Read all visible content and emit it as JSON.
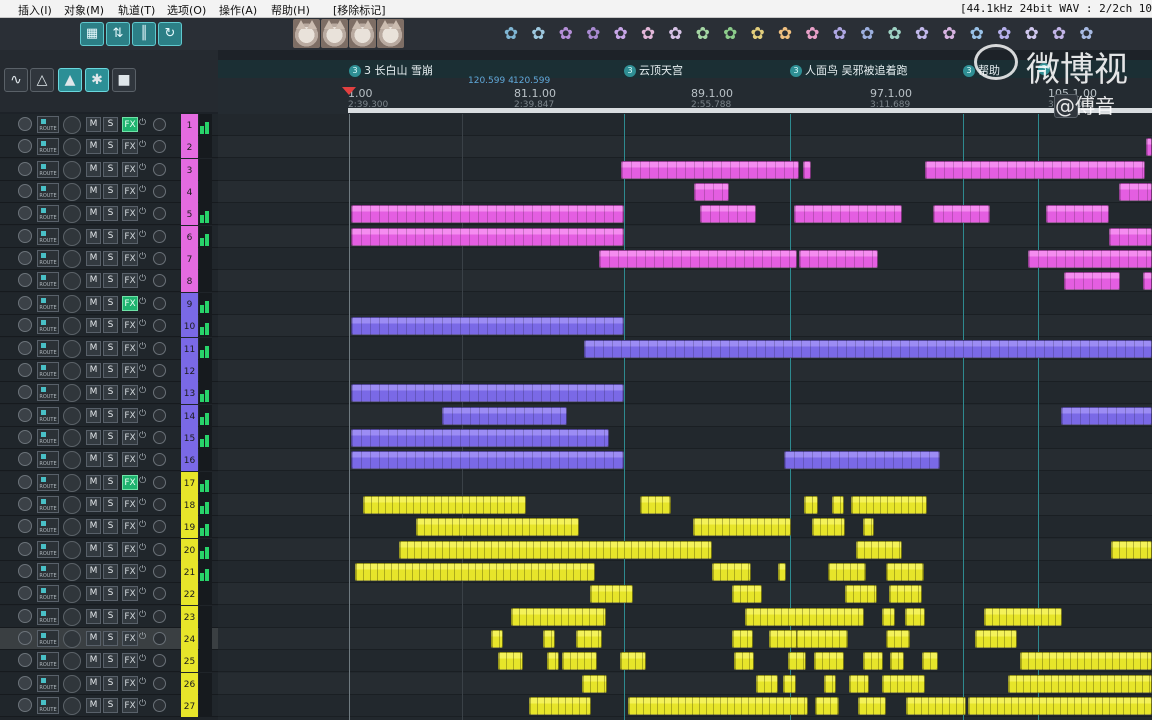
{
  "menu": {
    "items": [
      "插入(I)",
      "对象(M)",
      "轨道(T)",
      "选项(O)",
      "操作(A)",
      "帮助(H)",
      "[移除标记]"
    ],
    "format": "[44.1kHz 24bit WAV : 2/2ch 1024spl"
  },
  "toolbar": {
    "icons": [
      "grid-icon",
      "envelope-icon",
      "ripple-icon",
      "loop-icon"
    ]
  },
  "tools2": {
    "icons": [
      "snap-icon",
      "metronome-icon",
      "cursor-mode-icon",
      "glue-icon",
      "lock-icon"
    ]
  },
  "markers": [
    {
      "num": "3",
      "label": "3 长白山 雪崩"
    },
    {
      "num": "3",
      "label": "云顶天宫"
    },
    {
      "num": "3",
      "label": "人面鸟 吴邪被追着跑"
    },
    {
      "num": "3",
      "label": "帮助"
    },
    {
      "num": "3",
      "label": ""
    }
  ],
  "tempo": [
    "120.599 4",
    "120.599"
  ],
  "bars": [
    {
      "bar": "1.00",
      "time": "2:39.300"
    },
    {
      "bar": "81.1.00",
      "time": "2:39.847"
    },
    {
      "bar": "89.1.00",
      "time": "2:55.788"
    },
    {
      "bar": "97.1.00",
      "time": "3:11.689"
    },
    {
      "bar": "105.1.00",
      "time": "3:27.60"
    }
  ],
  "track_buttons": {
    "route": "ROUTE",
    "mute": "M",
    "solo": "S",
    "fx": "FX"
  },
  "tracks": [
    {
      "num": "1",
      "color": "#e46be0",
      "fx": true
    },
    {
      "num": "2",
      "color": "#e46be0",
      "fx": false
    },
    {
      "num": "3",
      "color": "#e46be0",
      "fx": false
    },
    {
      "num": "4",
      "color": "#e46be0",
      "fx": false
    },
    {
      "num": "5",
      "color": "#e46be0",
      "fx": false
    },
    {
      "num": "6",
      "color": "#e46be0",
      "fx": false
    },
    {
      "num": "7",
      "color": "#e46be0",
      "fx": false
    },
    {
      "num": "8",
      "color": "#e46be0",
      "fx": false
    },
    {
      "num": "9",
      "color": "#7a69e6",
      "fx": true
    },
    {
      "num": "10",
      "color": "#7a69e6",
      "fx": false
    },
    {
      "num": "11",
      "color": "#7a69e6",
      "fx": false
    },
    {
      "num": "12",
      "color": "#7a69e6",
      "fx": false
    },
    {
      "num": "13",
      "color": "#7a69e6",
      "fx": false
    },
    {
      "num": "14",
      "color": "#7a69e6",
      "fx": false
    },
    {
      "num": "15",
      "color": "#7a69e6",
      "fx": false
    },
    {
      "num": "16",
      "color": "#7a69e6",
      "fx": false
    },
    {
      "num": "17",
      "color": "#e7e52a",
      "fx": true
    },
    {
      "num": "18",
      "color": "#e7e52a",
      "fx": false
    },
    {
      "num": "19",
      "color": "#e7e52a",
      "fx": false
    },
    {
      "num": "20",
      "color": "#e7e52a",
      "fx": false
    },
    {
      "num": "21",
      "color": "#e7e52a",
      "fx": false
    },
    {
      "num": "22",
      "color": "#e7e52a",
      "fx": false
    },
    {
      "num": "23",
      "color": "#e7e52a",
      "fx": false
    },
    {
      "num": "24",
      "color": "#e7e52a",
      "fx": false
    },
    {
      "num": "25",
      "color": "#e7e52a",
      "fx": false
    },
    {
      "num": "26",
      "color": "#e7e52a",
      "fx": false
    },
    {
      "num": "27",
      "color": "#e7e52a",
      "fx": false
    }
  ],
  "watermark": {
    "brand": "微博视",
    "handle": "@傅音"
  }
}
